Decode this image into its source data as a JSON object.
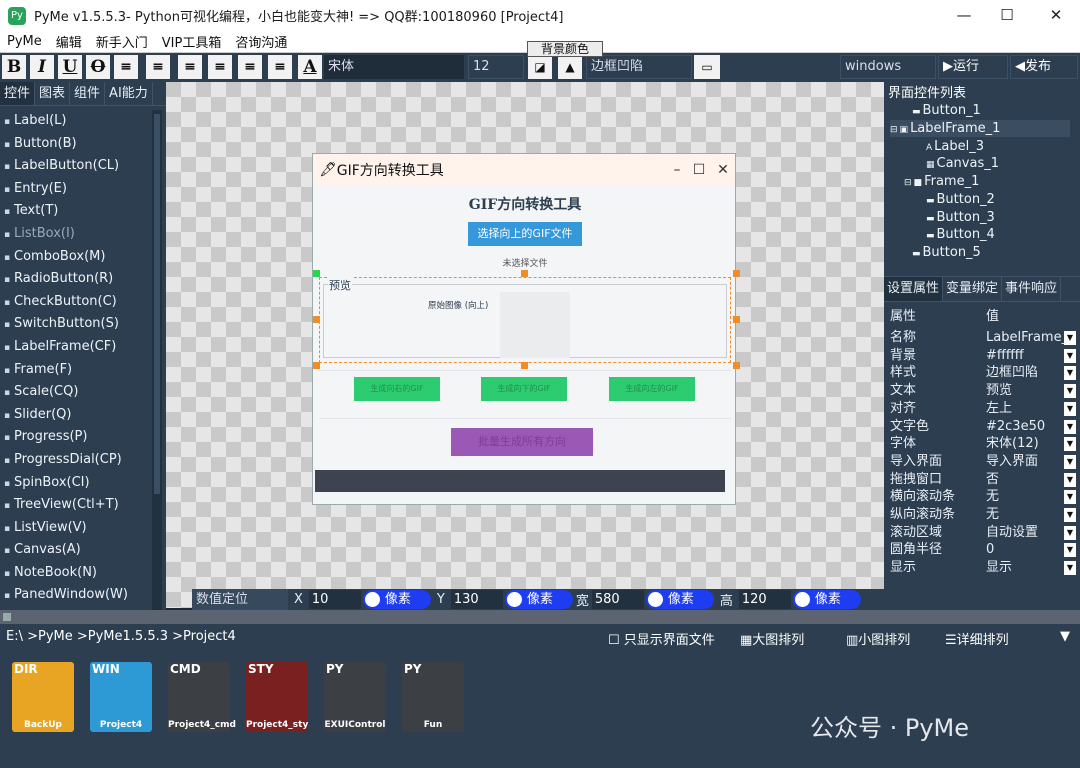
{
  "titlebar": {
    "title": "PyMe v1.5.5.3- Python可视化编程，小白也能变大神!   => QQ群:100180960     [Project4]",
    "min": "—",
    "max": "☐",
    "close": "✕"
  },
  "menu": [
    "PyMe",
    "编辑",
    "新手入门",
    "VIP工具箱",
    "咨询沟通"
  ],
  "toolbar": {
    "bold": "B",
    "italic": "I",
    "underline": "U",
    "strike": "O",
    "font_color_btn": "A",
    "font": "宋体",
    "size": "12",
    "bg_tooltip": "背景颜色",
    "relief": "边框凹陷",
    "theme": "windows",
    "run": "▶运行",
    "publish": "◀发布"
  },
  "left_tabs": [
    "控件",
    "图表",
    "组件",
    "AI能力"
  ],
  "components": [
    "Label(L)",
    "Button(B)",
    "LabelButton(CL)",
    "Entry(E)",
    "Text(T)",
    "ListBox(I)",
    "ComboBox(M)",
    "RadioButton(R)",
    "CheckButton(C)",
    "SwitchButton(S)",
    "LabelFrame(CF)",
    "Frame(F)",
    "Scale(CQ)",
    "Slider(Q)",
    "Progress(P)",
    "ProgressDial(CP)",
    "SpinBox(CI)",
    "TreeView(Ctl+T)",
    "ListView(V)",
    "Canvas(A)",
    "NoteBook(N)",
    "PanedWindow(W)"
  ],
  "design": {
    "window_title": "GIF方向转换工具",
    "heading": "GIF方向转换工具",
    "select_button": "选择向上的GIF文件",
    "no_file": "未选择文件",
    "frame_legend": "预览",
    "original_label": "原始图像 (向上)",
    "btn_right": "生成向右的GIF",
    "btn_down": "生成向下的GIF",
    "btn_left": "生成向左的GIF",
    "btn_all": "批量生成所有方向"
  },
  "posbar": {
    "mode": "数值定位",
    "x_label": "X",
    "x": "10",
    "y_label": "Y",
    "y": "130",
    "w_label": "宽",
    "w": "580",
    "h_label": "高",
    "h": "120",
    "unit": "像素"
  },
  "tree": {
    "header": "界面控件列表",
    "nodes": [
      "Button_1",
      "LabelFrame_1",
      "Label_3",
      "Canvas_1",
      "Frame_1",
      "Button_2",
      "Button_3",
      "Button_4",
      "Button_5"
    ]
  },
  "prop_tabs": [
    "设置属性",
    "变量绑定",
    "事件响应"
  ],
  "props": {
    "header_key": "属性",
    "header_val": "值",
    "rows": [
      {
        "k": "名称",
        "v": "LabelFrame_1"
      },
      {
        "k": "背景",
        "v": "#ffffff"
      },
      {
        "k": "样式",
        "v": "边框凹陷"
      },
      {
        "k": "文本",
        "v": "预览"
      },
      {
        "k": "对齐",
        "v": "左上"
      },
      {
        "k": "文字色",
        "v": "#2c3e50"
      },
      {
        "k": "字体",
        "v": "宋体(12)"
      },
      {
        "k": "导入界面",
        "v": "导入界面"
      },
      {
        "k": "拖拽窗口",
        "v": "否"
      },
      {
        "k": "横向滚动条",
        "v": "无"
      },
      {
        "k": "纵向滚动条",
        "v": "无"
      },
      {
        "k": "滚动区域",
        "v": "自动设置"
      },
      {
        "k": "圆角半径",
        "v": "0"
      },
      {
        "k": "显示",
        "v": "显示"
      }
    ]
  },
  "bottom": {
    "path": "E:\\ >PyMe >PyMe1.5.5.3 >Project4",
    "only_ui": "只显示界面文件",
    "large": "大图排列",
    "small": "小图排列",
    "detail": "详细排列",
    "files": [
      {
        "tag": "DIR",
        "name": "BackUp"
      },
      {
        "tag": "WIN",
        "name": "Project4"
      },
      {
        "tag": "CMD",
        "name": "Project4_cmd"
      },
      {
        "tag": "STY",
        "name": "Project4_sty"
      },
      {
        "tag": "PY",
        "name": "EXUIControl"
      },
      {
        "tag": "PY",
        "name": "Fun"
      }
    ],
    "watermark": "公众号 · PyMe"
  },
  "colors": {
    "panel": "#2c3e50",
    "accent_blue": "#3498db",
    "accent_green": "#2ecc71",
    "accent_purple": "#9b59b6",
    "selection": "#f28c28"
  }
}
